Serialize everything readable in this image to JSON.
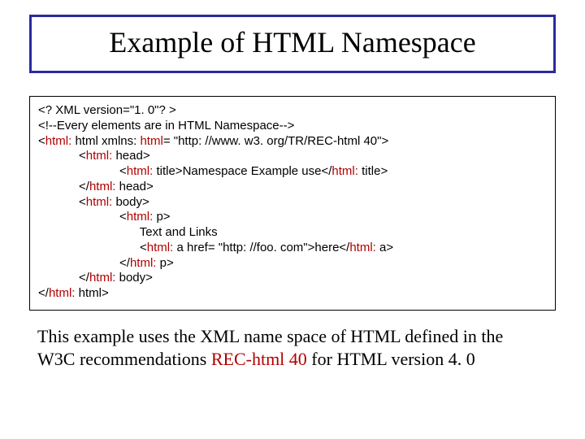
{
  "title": "Example of HTML Namespace",
  "code": {
    "l1": "<? XML version=\"1. 0\"? >",
    "l2": "<!--Every elements are in HTML Namespace-->",
    "l3a": "<",
    "l3b": "html:",
    "l3c": " html xmlns: ",
    "l3d": "html",
    "l3e": "= \"http: //www. w3. org/TR/REC-html 40\">",
    "l4a": "            <",
    "l4b": "html:",
    "l4c": " head>",
    "l5a": "                        <",
    "l5b": "html:",
    "l5c": " title>Namespace Example use</",
    "l5d": "html:",
    "l5e": " title>",
    "l6a": "            </",
    "l6b": "html:",
    "l6c": " head>",
    "l7a": "            <",
    "l7b": "html:",
    "l7c": " body>",
    "l8a": "                        <",
    "l8b": "html:",
    "l8c": " p>",
    "l9": "                              Text and Links",
    "l10a": "                              <",
    "l10b": "html:",
    "l10c": " a href= \"http: //foo. com\">here</",
    "l10d": "html:",
    "l10e": " a>",
    "l11a": "                        </",
    "l11b": "html:",
    "l11c": " p>",
    "l12a": "            </",
    "l12b": "html:",
    "l12c": " body>",
    "l13a": "</",
    "l13b": "html:",
    "l13c": " html>"
  },
  "caption": {
    "p1a": "This example uses the XML name space of HTML defined in the",
    "p2a": "W3C recommendations ",
    "p2b": "REC-html 40",
    "p2c": " for HTML version 4. 0"
  }
}
